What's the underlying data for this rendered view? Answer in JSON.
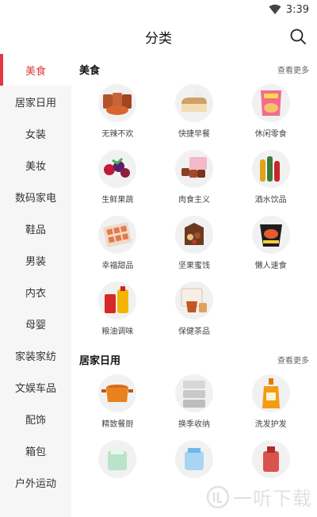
{
  "status_bar": {
    "time": "3:39",
    "wifi_icon": "wifi-icon"
  },
  "header": {
    "title": "分类",
    "search_icon": "search-icon"
  },
  "sidebar": {
    "items": [
      {
        "label": "美食",
        "active": true
      },
      {
        "label": "居家日用"
      },
      {
        "label": "女装"
      },
      {
        "label": "美妆"
      },
      {
        "label": "数码家电"
      },
      {
        "label": "鞋品"
      },
      {
        "label": "男装"
      },
      {
        "label": "内衣"
      },
      {
        "label": "母婴"
      },
      {
        "label": "家装家纺"
      },
      {
        "label": "文娱车品"
      },
      {
        "label": "配饰"
      },
      {
        "label": "箱包"
      },
      {
        "label": "户外运动"
      }
    ]
  },
  "sections": [
    {
      "title": "美食",
      "more": "查看更多",
      "items": [
        {
          "label": "无辣不欢",
          "icon": "spicy-snack-icon"
        },
        {
          "label": "快捷早餐",
          "icon": "bread-icon"
        },
        {
          "label": "休闲零食",
          "icon": "chips-icon"
        },
        {
          "label": "生鲜果蔬",
          "icon": "fruit-icon"
        },
        {
          "label": "肉食主义",
          "icon": "meat-icon"
        },
        {
          "label": "酒水饮品",
          "icon": "drinks-icon"
        },
        {
          "label": "幸福甜品",
          "icon": "dessert-icon"
        },
        {
          "label": "坚果蜜饯",
          "icon": "nuts-icon"
        },
        {
          "label": "懒人速食",
          "icon": "instant-food-icon"
        },
        {
          "label": "粮油调味",
          "icon": "oil-icon"
        },
        {
          "label": "保健茶品",
          "icon": "tea-icon"
        }
      ]
    },
    {
      "title": "居家日用",
      "more": "查看更多",
      "items": [
        {
          "label": "精致餐厨",
          "icon": "pot-icon"
        },
        {
          "label": "换季收纳",
          "icon": "storage-icon"
        },
        {
          "label": "洗发护发",
          "icon": "shampoo-icon"
        },
        {
          "label": "",
          "icon": "tissue-icon"
        },
        {
          "label": "",
          "icon": "cleaning-icon"
        },
        {
          "label": "",
          "icon": "detergent-icon"
        }
      ]
    }
  ],
  "watermark": {
    "text": "一听下载"
  },
  "colors": {
    "accent": "#e2393f",
    "sidebar_bg": "#f6f6f6"
  }
}
